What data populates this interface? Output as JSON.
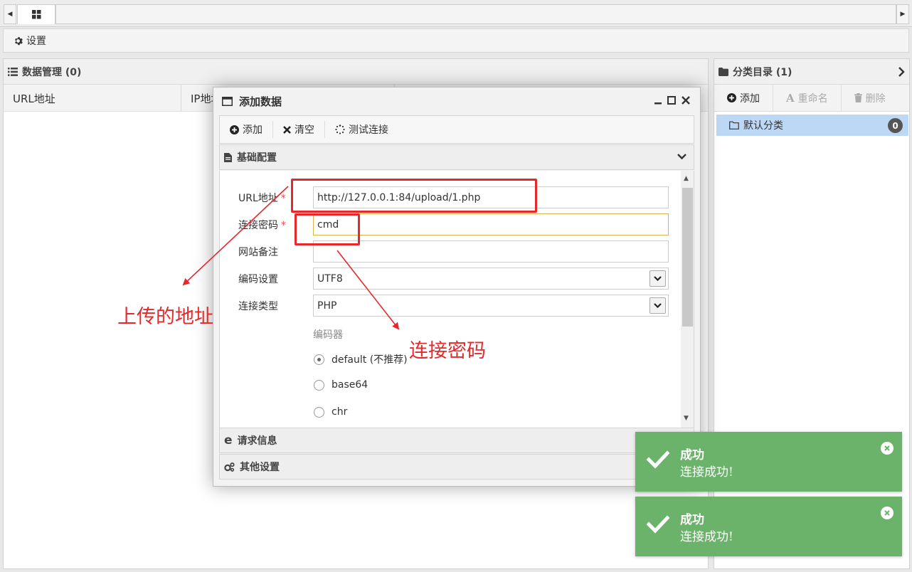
{
  "tabbar": {
    "home_icon": "grid-icon"
  },
  "toolbar": {
    "settings_label": "设置"
  },
  "left_panel": {
    "title": "数据管理 (0)",
    "columns": [
      "URL地址",
      "IP地址"
    ]
  },
  "right_panel": {
    "title": "分类目录 (1)",
    "tools": {
      "add": "添加",
      "rename": "重命名",
      "delete": "删除"
    },
    "categories": [
      {
        "label": "默认分类",
        "count": "0"
      }
    ]
  },
  "dialog": {
    "title": "添加数据",
    "toolbar": {
      "add": "添加",
      "clear": "清空",
      "test": "测试连接"
    },
    "sections": {
      "basic": "基础配置",
      "request": "请求信息",
      "other": "其他设置"
    },
    "form": {
      "url_label": "URL地址",
      "url_value": "http://127.0.0.1:84/upload/1.php",
      "password_label": "连接密码",
      "password_value": "cmd",
      "note_label": "网站备注",
      "note_value": "",
      "encoding_label": "编码设置",
      "encoding_value": "UTF8",
      "type_label": "连接类型",
      "type_value": "PHP",
      "encoder_label": "编码器",
      "encoders": [
        "default (不推荐)",
        "base64",
        "chr"
      ],
      "encoder_selected": "default (不推荐)"
    }
  },
  "annotations": {
    "upload_address": "上传的地址",
    "connect_password": "连接密码"
  },
  "toasts": [
    {
      "title": "成功",
      "message": "连接成功!"
    },
    {
      "title": "成功",
      "message": "连接成功!"
    }
  ],
  "colors": {
    "toast_green": "#6bb26b",
    "annotation_red": "#e5282b",
    "selection_blue": "#bcd8f5"
  }
}
